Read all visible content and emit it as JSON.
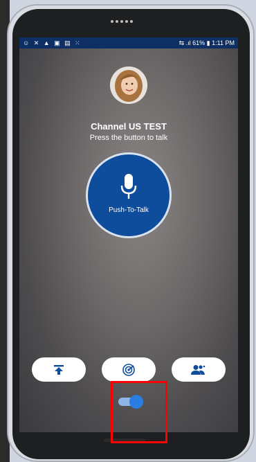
{
  "status_bar": {
    "left_icons": "☺ ✕ ▲ ▣ ▤ ⁙",
    "signal_icons": "⇆ .ıl",
    "battery_percent": "61%",
    "time": "1:11 PM"
  },
  "channel": {
    "name": "Channel US TEST",
    "instruction": "Press the button to talk"
  },
  "ptt_button": {
    "label": "Push-To-Talk"
  },
  "actions": [
    {
      "icon": "upload-icon"
    },
    {
      "icon": "radar-icon"
    },
    {
      "icon": "contacts-icon"
    }
  ],
  "toggle": {
    "state": "on",
    "color": "#2a7de1"
  },
  "colors": {
    "status_bar": "#0d2f63",
    "ptt": "#0e4c9c",
    "highlight": "#ff0000"
  }
}
